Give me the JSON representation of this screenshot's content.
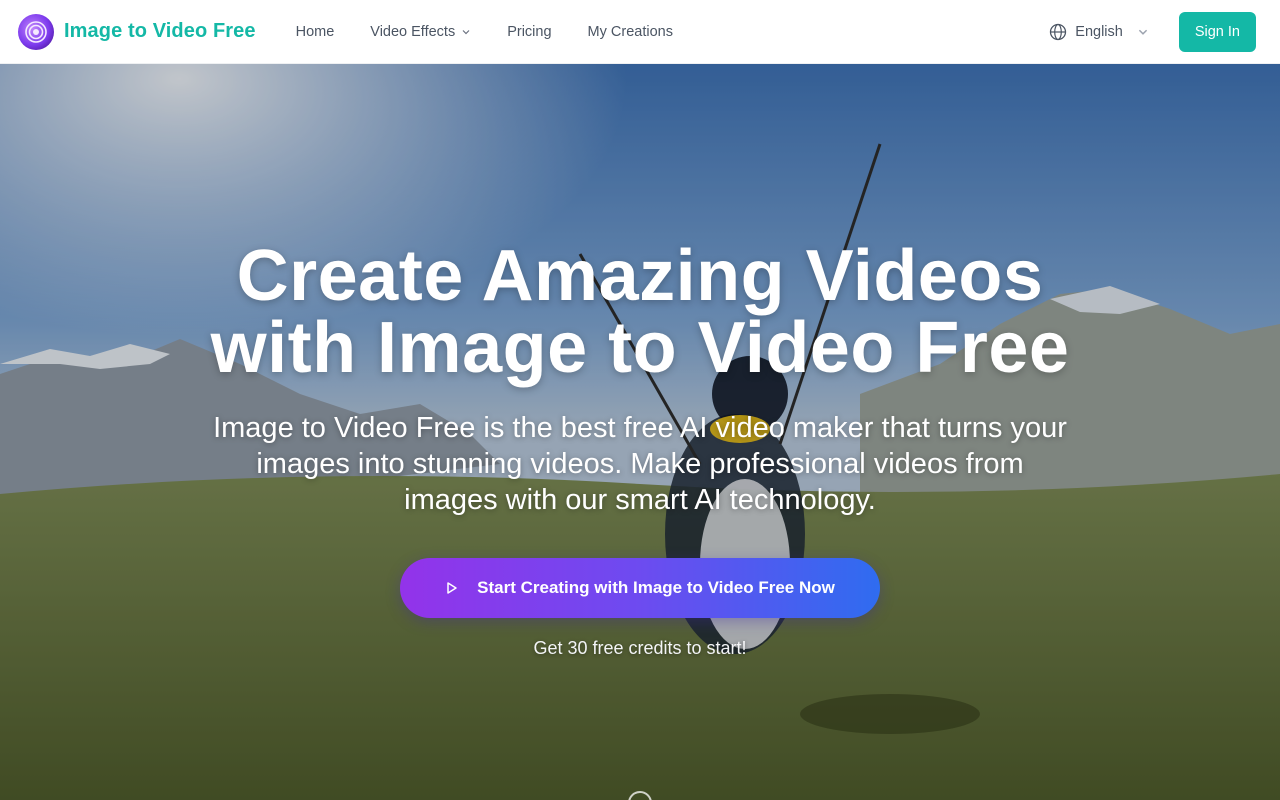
{
  "header": {
    "brand": "Image to Video Free",
    "nav": [
      {
        "label": "Home"
      },
      {
        "label": "Video Effects"
      },
      {
        "label": "Pricing"
      },
      {
        "label": "My Creations"
      }
    ],
    "language": "English",
    "sign_in": "Sign In"
  },
  "hero": {
    "title": "Create Amazing Videos with Image to Video Free",
    "subtitle": "Image to Video Free is the best free AI video maker that turns your images into stunning videos. Make professional videos from images with our smart AI technology.",
    "cta": "Start Creating with Image to Video Free Now",
    "credits": "Get 30 free credits to start!"
  },
  "colors": {
    "brand": "#14b8a6",
    "cta_start": "#9333ea",
    "cta_end": "#2f6cf0"
  },
  "icons": {
    "logo": "spiral-logo-icon",
    "globe": "globe-icon",
    "dropdown": "chevron-down-icon",
    "play": "play-icon"
  }
}
